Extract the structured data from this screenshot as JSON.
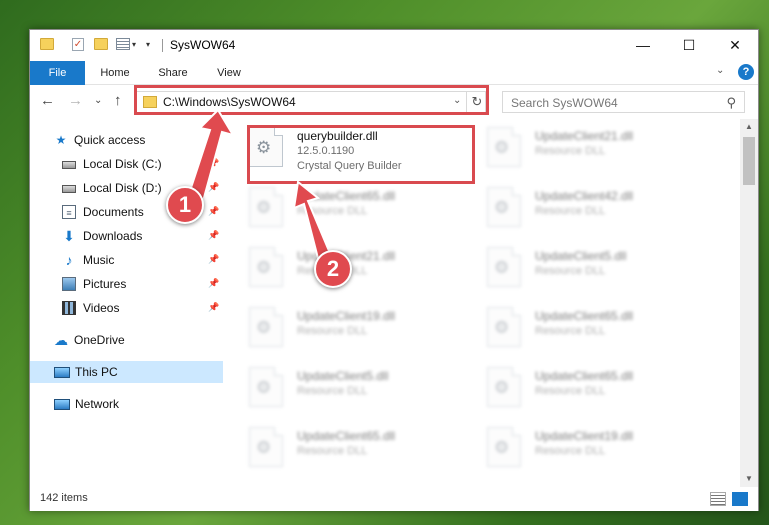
{
  "window": {
    "title": "SysWOW64",
    "controls": {
      "minimize": "—",
      "maximize": "☐",
      "close": "✕"
    }
  },
  "ribbon": {
    "tabs": [
      "File",
      "Home",
      "Share",
      "View"
    ],
    "expand_glyph": "⌄",
    "help_glyph": "?"
  },
  "navigation": {
    "back_glyph": "←",
    "forward_glyph": "→",
    "recent_glyph": "⌄",
    "up_glyph": "↑",
    "address": "C:\\Windows\\SysWOW64",
    "address_dropdown_glyph": "⌄",
    "refresh_glyph": "↻",
    "search_placeholder": "Search SysWOW64",
    "search_glyph": "⚲"
  },
  "sidebar": {
    "items": [
      {
        "label": "Quick access",
        "icon": "star-icon",
        "pinned": false
      },
      {
        "label": "Local Disk (C:)",
        "icon": "drive-icon",
        "pinned": true
      },
      {
        "label": "Local Disk (D:)",
        "icon": "drive-icon",
        "pinned": true
      },
      {
        "label": "Documents",
        "icon": "documents-icon",
        "pinned": true
      },
      {
        "label": "Downloads",
        "icon": "download-icon",
        "pinned": true
      },
      {
        "label": "Music",
        "icon": "music-icon",
        "pinned": true
      },
      {
        "label": "Pictures",
        "icon": "pictures-icon",
        "pinned": true
      },
      {
        "label": "Videos",
        "icon": "videos-icon",
        "pinned": true
      },
      {
        "label": "OneDrive",
        "icon": "cloud-icon",
        "pinned": false
      },
      {
        "label": "This PC",
        "icon": "computer-icon",
        "pinned": false,
        "selected": true
      },
      {
        "label": "Network",
        "icon": "network-icon",
        "pinned": false
      }
    ],
    "pin_glyph": "📌"
  },
  "files": {
    "highlighted": {
      "name": "querybuilder.dll",
      "version": "12.5.0.1190",
      "description": "Crystal Query Builder"
    },
    "left_column": [
      {
        "name": "UpdateClient65.dll",
        "type": "Resource DLL"
      },
      {
        "name": "UpdateClient21.dll",
        "type": "Resource DLL"
      },
      {
        "name": "UpdateClient19.dll",
        "type": "Resource DLL"
      },
      {
        "name": "UpdateClient5.dll",
        "type": "Resource DLL"
      },
      {
        "name": "UpdateClient65.dll",
        "type": "Resource DLL"
      }
    ],
    "right_column": [
      {
        "name": "UpdateClient21.dll",
        "type": "Resource DLL"
      },
      {
        "name": "UpdateClient42.dll",
        "type": "Resource DLL"
      },
      {
        "name": "UpdateClient5.dll",
        "type": "Resource DLL"
      },
      {
        "name": "UpdateClient65.dll",
        "type": "Resource DLL"
      },
      {
        "name": "UpdateClient65.dll",
        "type": "Resource DLL"
      },
      {
        "name": "UpdateClient19.dll",
        "type": "Resource DLL"
      }
    ]
  },
  "status": {
    "item_count": "142 items"
  },
  "annotations": {
    "badge_1": "1",
    "badge_2": "2",
    "color": "#e04a4f",
    "box_color": "#d94a4f"
  }
}
